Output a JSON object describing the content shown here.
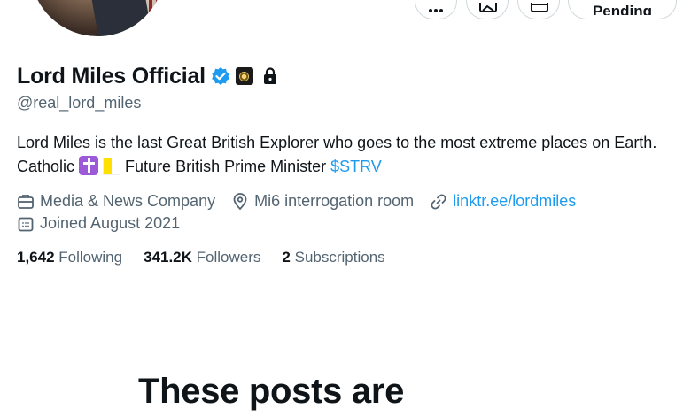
{
  "profile": {
    "display_name": "Lord Miles Official",
    "handle": "@real_lord_miles",
    "bio_text_1": "Lord Miles is the last Great British Explorer who goes to the most extreme places on Earth. Catholic ",
    "bio_text_2": " Future British Prime Minister ",
    "bio_cashtag": "$STRV",
    "category": "Media & News Company",
    "location": "Mi6 interrogation room",
    "website": "linktr.ee/lordmiles",
    "joined": "Joined August 2021"
  },
  "actions": {
    "pending_label": "Pending"
  },
  "stats": {
    "following_count": "1,642",
    "following_label": "Following",
    "followers_count": "341.2K",
    "followers_label": "Followers",
    "subscriptions_count": "2",
    "subscriptions_label": "Subscriptions"
  },
  "protected_notice": {
    "title": "These posts are"
  },
  "icons": {
    "verified": "verified-badge-icon",
    "affiliate": "affiliate-badge-icon",
    "protected": "lock-icon",
    "category": "briefcase-icon",
    "location": "location-pin-icon",
    "website": "link-icon",
    "joined": "calendar-icon"
  },
  "colors": {
    "accent": "#1d9bf0",
    "secondary_text": "#536471",
    "primary_text": "#0f1419"
  }
}
